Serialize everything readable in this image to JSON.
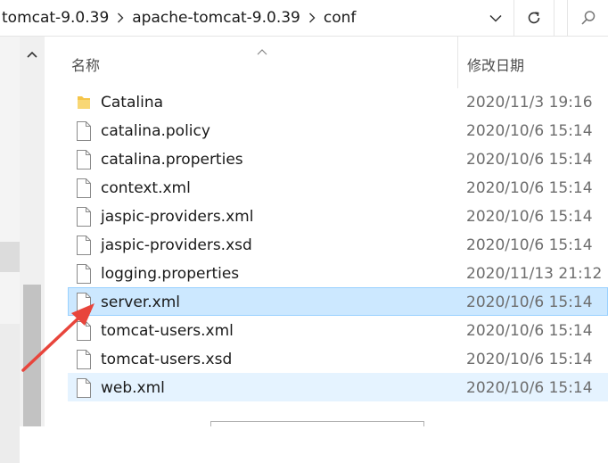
{
  "address_bar": {
    "crumbs": [
      "tomcat-9.0.39",
      "apache-tomcat-9.0.39",
      "conf"
    ],
    "icons": {
      "separator": "chevron-right-icon",
      "dropdown": "chevron-down-icon",
      "refresh": "refresh-icon",
      "search": "search-icon"
    }
  },
  "columns": {
    "name": "名称",
    "date_modified": "修改日期"
  },
  "files": [
    {
      "name": "Catalina",
      "date": "2020/11/3 19:16",
      "type": "folder"
    },
    {
      "name": "catalina.policy",
      "date": "2020/10/6 15:14",
      "type": "file"
    },
    {
      "name": "catalina.properties",
      "date": "2020/10/6 15:14",
      "type": "file"
    },
    {
      "name": "context.xml",
      "date": "2020/10/6 15:14",
      "type": "file"
    },
    {
      "name": "jaspic-providers.xml",
      "date": "2020/10/6 15:14",
      "type": "file"
    },
    {
      "name": "jaspic-providers.xsd",
      "date": "2020/10/6 15:14",
      "type": "file"
    },
    {
      "name": "logging.properties",
      "date": "2020/11/13 21:12",
      "type": "file"
    },
    {
      "name": "server.xml",
      "date": "2020/10/6 15:14",
      "type": "file",
      "state": "selected"
    },
    {
      "name": "tomcat-users.xml",
      "date": "2020/10/6 15:14",
      "type": "file"
    },
    {
      "name": "tomcat-users.xsd",
      "date": "2020/10/6 15:14",
      "type": "file"
    },
    {
      "name": "web.xml",
      "date": "2020/10/6 15:14",
      "type": "file",
      "state": "hover"
    }
  ],
  "colors": {
    "selected_bg": "#cce8ff",
    "selected_border": "#99d1ff",
    "hover_bg": "#e5f3ff",
    "annotation_arrow": "#e8453c",
    "folder_icon": "#f5c54a"
  }
}
